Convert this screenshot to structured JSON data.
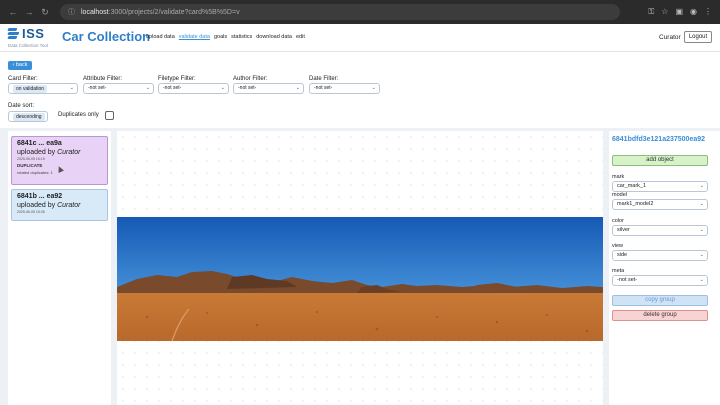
{
  "browser": {
    "url_host": "localhost",
    "url_path": ":3000/projects/2/validate?card%5B%5D=v",
    "icons": [
      "back-arrow-icon",
      "forward-arrow-icon",
      "reload-icon",
      "info-icon",
      "key-icon",
      "star-icon",
      "extension-icon",
      "profile-icon",
      "menu-icon"
    ]
  },
  "header": {
    "logo_text": "ISS",
    "logo_sub": "Data Collection Tool",
    "title": "Car Collection",
    "nav": [
      "upload data",
      "validate data",
      "goals",
      "statistics",
      "download data",
      "edit"
    ],
    "active_nav": "validate data",
    "user": "Curator",
    "logout": "Logout"
  },
  "back_label": "back",
  "filters": {
    "card": {
      "label": "Card Filter:",
      "value": "on validation"
    },
    "attribute": {
      "label": "Attribute Filter:",
      "value": "-not set-"
    },
    "filetype": {
      "label": "Filetype Filter:",
      "value": "-not set-"
    },
    "author": {
      "label": "Author Filter:",
      "value": "-not set-"
    },
    "date": {
      "label": "Date Filter:",
      "value": "-not set-"
    }
  },
  "date_sort": {
    "label": "Date sort:",
    "value": "descending"
  },
  "duplicates_only": {
    "label": "Duplicates only",
    "checked": false
  },
  "cards": [
    {
      "title": "6841c ... ea9a",
      "uploaded_prefix": "uploaded by",
      "uploader": "Curator",
      "date": "2025-06-05 16:15",
      "badge": "DUPLICATE",
      "related": "related duplicates: 1"
    },
    {
      "title": "6841b ... ea92",
      "uploaded_prefix": "uploaded by",
      "uploader": "Curator",
      "date": "2025-06-05 15:35"
    }
  ],
  "panel": {
    "object_id": "6841bdfd3e121a237500ea92",
    "add_object": "add object",
    "fields": [
      {
        "label": "mark",
        "value": "car_mark_1"
      },
      {
        "label": "model",
        "value": "mark1_model2"
      },
      {
        "label": "color",
        "value": "silver"
      },
      {
        "label": "view",
        "value": "side"
      },
      {
        "label": "meta",
        "value": "-not set-"
      }
    ],
    "copy_group": "copy group",
    "delete_group": "delete group"
  },
  "colors": {
    "accent": "#3a8fd9",
    "duplicate_card": "#e8d3f6",
    "normal_card": "#d8e9f8",
    "add_button": "#d7f2c9",
    "delete_button": "#f8d3d3"
  }
}
